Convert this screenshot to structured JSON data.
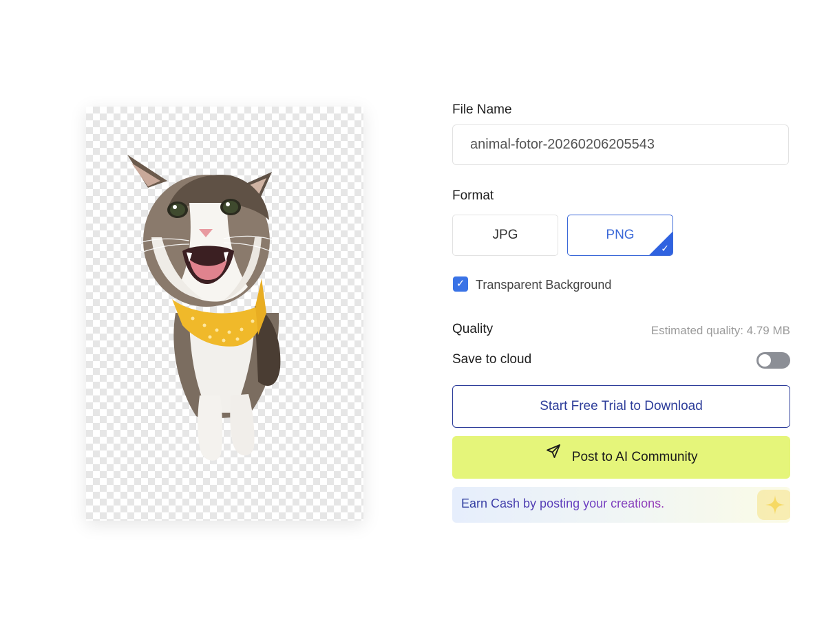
{
  "file_name": {
    "label": "File Name",
    "value": "animal-fotor-20260206205543"
  },
  "format": {
    "label": "Format",
    "options": [
      "JPG",
      "PNG"
    ],
    "selected": "PNG",
    "check_glyph": "✓"
  },
  "transparent_background": {
    "label": "Transparent Background",
    "checked": true,
    "check_glyph": "✓"
  },
  "quality": {
    "label": "Quality",
    "estimate": "Estimated quality: 4.79 MB"
  },
  "save_to_cloud": {
    "label": "Save to cloud",
    "enabled": false
  },
  "buttons": {
    "trial": "Start Free Trial to Download",
    "post": "Post to AI Community",
    "post_icon": "send-icon"
  },
  "promo": {
    "text": "Earn Cash by posting your creations.",
    "icon": "sparkle-icon"
  },
  "preview": {
    "subject": "cat-with-yellow-bandana",
    "background": "transparent-checkerboard"
  },
  "colors": {
    "accent_blue": "#3a68d8",
    "trial_border": "#2d3d9a",
    "post_bg": "#e5f57a",
    "toggle_off": "#8c8f96"
  }
}
